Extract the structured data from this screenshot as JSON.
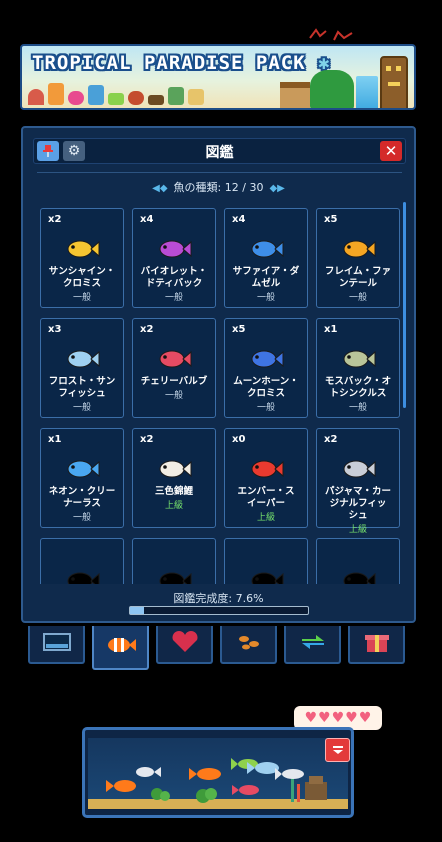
{
  "banner": {
    "title": "TROPICAL PARADISE PACK",
    "flower_glyph": "✱"
  },
  "panel": {
    "title": "図鑑",
    "species_label": "魚の種類: 12 / 30",
    "completion_label": "図鑑完成度: 7.6%",
    "completion_value": 0.076,
    "icons": [
      "pin-icon",
      "gear-icon",
      "close-icon"
    ]
  },
  "fish": [
    {
      "count": "x2",
      "name_lines": [
        "サンシャイン・",
        "クロミス"
      ],
      "rarity": "一般",
      "rare": false,
      "color": "#f6c531"
    },
    {
      "count": "x4",
      "name_lines": [
        "バイオレット・",
        "ドティバック"
      ],
      "rarity": "一般",
      "rare": false,
      "color": "#b94cd4"
    },
    {
      "count": "x4",
      "name_lines": [
        "サファイア・ダ",
        "ムゼル"
      ],
      "rarity": "一般",
      "rare": false,
      "color": "#3e8ee8"
    },
    {
      "count": "x5",
      "name_lines": [
        "フレイム・ファ",
        "ンテール"
      ],
      "rarity": "一般",
      "rare": false,
      "color": "#f5a623"
    },
    {
      "count": "x3",
      "name_lines": [
        "フロスト・サン",
        "フィッシュ"
      ],
      "rarity": "一般",
      "rare": false,
      "color": "#9fd0f0"
    },
    {
      "count": "x2",
      "name_lines": [
        "チェリーバルブ"
      ],
      "rarity": "一般",
      "rare": false,
      "color": "#e64b63"
    },
    {
      "count": "x5",
      "name_lines": [
        "ムーンホーン・",
        "クロミス"
      ],
      "rarity": "一般",
      "rare": false,
      "color": "#3f74e3"
    },
    {
      "count": "x1",
      "name_lines": [
        "モスバック・オ",
        "トシンクルス"
      ],
      "rarity": "一般",
      "rare": false,
      "color": "#b9c59a"
    },
    {
      "count": "x1",
      "name_lines": [
        "ネオン・クリー",
        "ナーラス"
      ],
      "rarity": "一般",
      "rare": false,
      "color": "#4aa7f0"
    },
    {
      "count": "x2",
      "name_lines": [
        "三色錦鯉"
      ],
      "rarity": "上級",
      "rare": true,
      "color": "#f2ede4"
    },
    {
      "count": "x0",
      "name_lines": [
        "エンバー・ス",
        "イーパー"
      ],
      "rarity": "上級",
      "rare": true,
      "color": "#e93a2f"
    },
    {
      "count": "x2",
      "name_lines": [
        "パジャマ・カー",
        "ジナルフィッ",
        "シュ"
      ],
      "rarity": "上級",
      "rare": true,
      "color": "#c9ced8"
    }
  ],
  "locked_cards": 4,
  "tabs": [
    {
      "icon": "aquarium-tab-icon",
      "color": "#5aa3d8"
    },
    {
      "icon": "clownfish-tab-icon",
      "color": "#ff7a1a",
      "active": true
    },
    {
      "icon": "heart-tab-icon",
      "color": "#d8304d"
    },
    {
      "icon": "fish-food-tab-icon",
      "color": "#e3892b"
    },
    {
      "icon": "exchange-tab-icon",
      "color": "#35a7e8"
    },
    {
      "icon": "gift-tab-icon",
      "color": "#d94456"
    }
  ],
  "tank": {
    "hearts": 5,
    "hearts_glyph": "♥"
  }
}
